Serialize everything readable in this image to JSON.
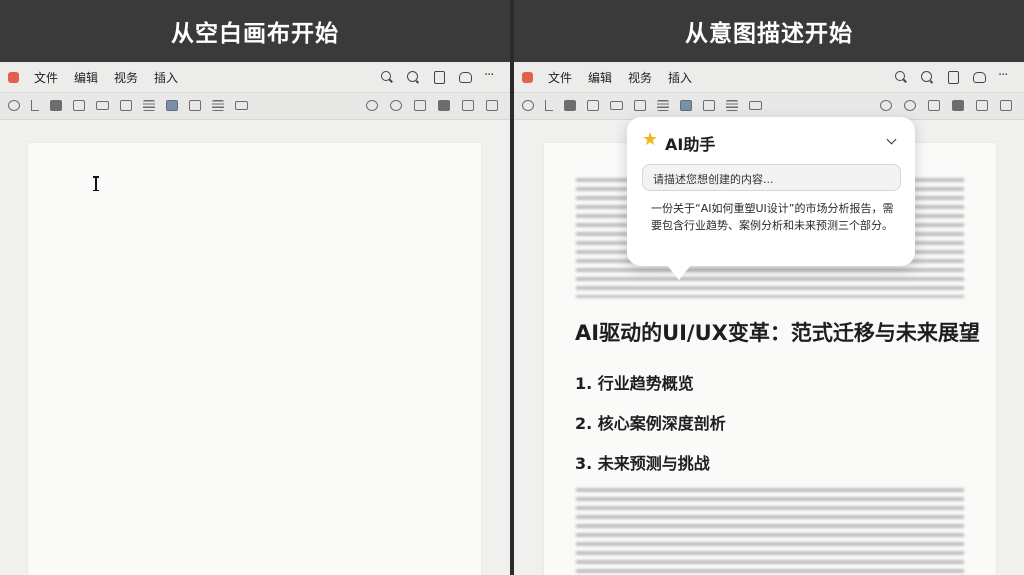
{
  "left_panel": {
    "caption": "从空白画布开始",
    "menu": [
      "文件",
      "编辑",
      "视务",
      "插入"
    ]
  },
  "right_panel": {
    "caption": "从意图描述开始",
    "menu": [
      "文件",
      "编辑",
      "视务",
      "插入"
    ],
    "ai_assistant": {
      "title": "AI助手",
      "input_placeholder": "请描述您想创建的内容...",
      "prompt_text": "一份关于“AI如何重塑UI设计”的市场分析报告，需要包含行业趋势、案例分析和未来预测三个部分。"
    },
    "document": {
      "title": "AI驱动的UI/UX变革：范式迁移与未来展望",
      "sections": [
        "1. 行业趋势概览",
        "2. 核心案例深度剖析",
        "3. 未来预测与挑战"
      ]
    }
  },
  "colors": {
    "caption_bar": "#3a3a3a",
    "app_icon": "#e2614b",
    "star": "#f3b51b"
  },
  "icons": [
    "search-icon",
    "zoom-icon",
    "document-icon",
    "comment-icon",
    "more-icon",
    "star-icon",
    "chevron-down-icon"
  ]
}
